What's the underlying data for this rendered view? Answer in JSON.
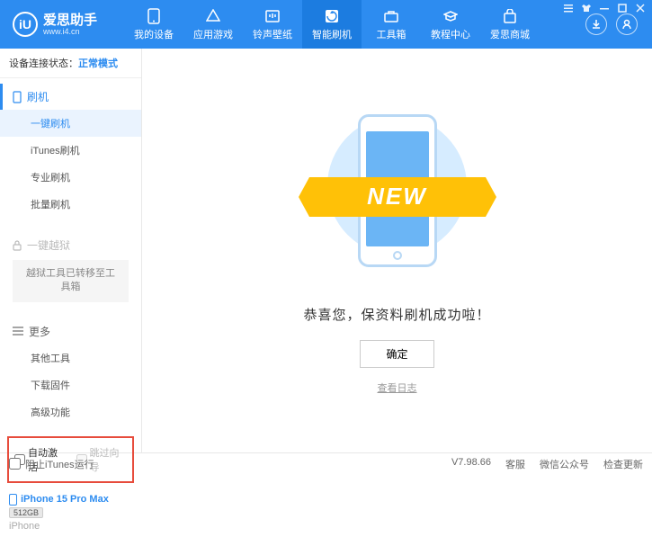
{
  "header": {
    "logo_text": "爱思助手",
    "logo_sub": "www.i4.cn",
    "logo_letter": "iU",
    "nav": [
      {
        "label": "我的设备"
      },
      {
        "label": "应用游戏"
      },
      {
        "label": "铃声壁纸"
      },
      {
        "label": "智能刷机"
      },
      {
        "label": "工具箱"
      },
      {
        "label": "教程中心"
      },
      {
        "label": "爱思商城"
      }
    ]
  },
  "status": {
    "label": "设备连接状态：",
    "mode": "正常模式"
  },
  "sidebar": {
    "flash_head": "刷机",
    "items_flash": [
      {
        "label": "一键刷机"
      },
      {
        "label": "iTunes刷机"
      },
      {
        "label": "专业刷机"
      },
      {
        "label": "批量刷机"
      }
    ],
    "jailbreak_head": "一键越狱",
    "jailbreak_note": "越狱工具已转移至工具箱",
    "more_head": "更多",
    "items_more": [
      {
        "label": "其他工具"
      },
      {
        "label": "下载固件"
      },
      {
        "label": "高级功能"
      }
    ]
  },
  "checkboxes": {
    "auto_activate": "自动激活",
    "skip_guide": "跳过向导"
  },
  "device": {
    "name": "iPhone 15 Pro Max",
    "storage": "512GB",
    "type": "iPhone"
  },
  "main": {
    "ribbon": "NEW",
    "success": "恭喜您，保资料刷机成功啦！",
    "ok": "确定",
    "view_log": "查看日志"
  },
  "footer": {
    "block_itunes": "阻止iTunes运行",
    "version": "V7.98.66",
    "links": [
      "客服",
      "微信公众号",
      "检查更新"
    ]
  }
}
